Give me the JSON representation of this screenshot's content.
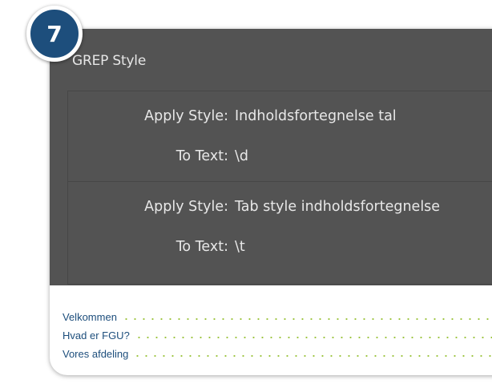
{
  "step_badge": "7",
  "dialog": {
    "title": "GREP Style",
    "rules": [
      {
        "apply_label": "Apply Style:",
        "apply_value": "Indholdsfortegnelse tal",
        "text_label": "To Text:",
        "text_value": "\\d"
      },
      {
        "apply_label": "Apply Style:",
        "apply_value": "Tab style indholdsfortegnelse",
        "text_label": "To Text:",
        "text_value": "\\t"
      }
    ]
  },
  "toc": {
    "items": [
      {
        "label": "Velkommen"
      },
      {
        "label": "Hvad er FGU?"
      },
      {
        "label": "Vores afdeling"
      }
    ]
  },
  "colors": {
    "badge": "#1d4e7c",
    "panel": "#535353",
    "toc_text": "#1d4e7c",
    "toc_leader": "#9bc43c"
  }
}
